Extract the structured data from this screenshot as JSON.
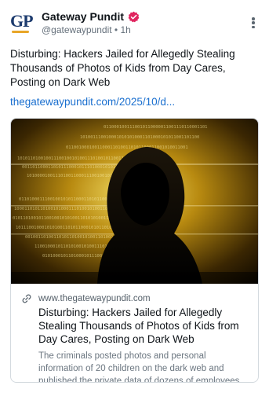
{
  "post": {
    "author": {
      "name": "Gateway Pundit",
      "handle": "@gatewaypundit",
      "separator": "•",
      "time": "1h",
      "avatar_text": "GP",
      "verified": true,
      "badge_color": "#e0245e"
    },
    "menu_icon": "kebab-menu-icon",
    "text": "Disturbing: Hackers Jailed for Allegedly Stealing Thousands of Photos of Kids from Day Cares, Posting on Dark Web",
    "link": "thegatewaypundit.com/2025/10/d..."
  },
  "card": {
    "image_desc_icon": "hooded-hacker-image",
    "domain": "www.thegatewaypundit.com",
    "domain_icon": "link-icon",
    "title": "Disturbing: Hackers Jailed for Allegedly Stealing Thousands of Photos of Kids from Day Cares, Posting on Dark Web",
    "description": "The criminals posted photos and personal information of 20 children on the dark web and published the private data of dozens of employees."
  },
  "colors": {
    "link": "#1a6fcf",
    "secondary_text": "#65707b",
    "accent_gold": "#e8a628"
  }
}
